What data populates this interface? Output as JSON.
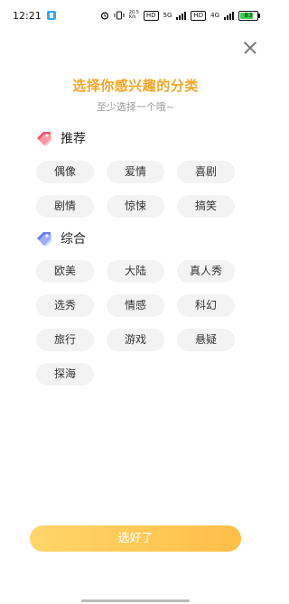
{
  "status_bar": {
    "time": "12:21",
    "net_speed": "20.5\nK/s",
    "hd1": "HD",
    "hd2": "HD",
    "signal1": "5G",
    "signal2": "4G",
    "battery": "83"
  },
  "page": {
    "title": "选择你感兴趣的分类",
    "subtitle": "至少选择一个哦~"
  },
  "sections": {
    "recommend": {
      "label": "推荐",
      "icon_color": "#f25a6b",
      "items": [
        "偶像",
        "爱情",
        "喜剧",
        "剧情",
        "惊悚",
        "搞笑"
      ]
    },
    "general": {
      "label": "综合",
      "icon_color": "#6b7df0",
      "items": [
        "欧美",
        "大陆",
        "真人秀",
        "选秀",
        "情感",
        "科幻",
        "旅行",
        "游戏",
        "悬疑",
        "探海"
      ]
    }
  },
  "confirm_label": "选好了",
  "colors": {
    "accent": "#f5a623",
    "button_gradient_start": "#ffd56a",
    "button_gradient_end": "#ffbf47"
  }
}
